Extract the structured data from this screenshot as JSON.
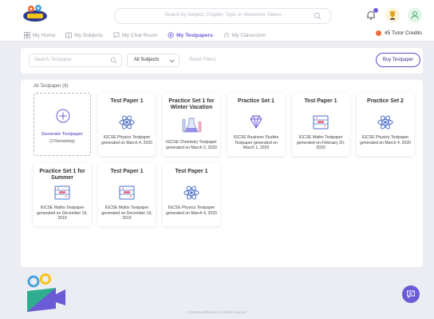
{
  "header": {
    "search_placeholder": "Search by Subject, Chapter, Topic or Interactive Videos",
    "notification_count": "",
    "credits_label": "45 Tutor Credits"
  },
  "nav": {
    "items": [
      {
        "label": "My Home",
        "icon": "grid-icon"
      },
      {
        "label": "My Subjects",
        "icon": "book-icon"
      },
      {
        "label": "My Chat Room",
        "icon": "chat-icon"
      },
      {
        "label": "My Testpapers",
        "icon": "testpaper-icon",
        "active": true
      },
      {
        "label": "My Classroom",
        "icon": "classroom-icon"
      }
    ]
  },
  "filters": {
    "search_placeholder": "Search Testpaper",
    "subject_select": "All Subjects",
    "reset_label": "Reset Filters",
    "buy_label": "Buy Testpaper"
  },
  "panel": {
    "title": "All Testpaper (8)",
    "generate": {
      "label": "Generate Testpaper",
      "sub": "(2 Remaining)"
    }
  },
  "cards": [
    {
      "title": "Test Paper 1",
      "icon": "atom-icon",
      "desc": "IGCSE Physics Testpaper generated on March 4, 2020"
    },
    {
      "title": "Practice Set 1 for Winter Vacation",
      "icon": "flask-icon",
      "desc": "IGCSE Chemistry Testpaper generated on March 2, 2020"
    },
    {
      "title": "Practice Set 1",
      "icon": "diamond-icon",
      "desc": "IGCSE Business Studies Testpaper generated on March 1, 2020"
    },
    {
      "title": "Test Paper 1",
      "icon": "abacus-icon",
      "desc": "IGCSE Maths Testpaper generated on February 20, 2020"
    },
    {
      "title": "Practice Set 2",
      "icon": "atom-icon",
      "desc": "IGCSE Physics Testpaper generated on March 4, 2020"
    },
    {
      "title": "Practice Set 1 for Summer",
      "icon": "abacus-icon",
      "desc": "IGCSE Maths Testpaper generated on December 19, 2019"
    },
    {
      "title": "Test Paper 1",
      "icon": "abacus-icon",
      "desc": "IGCSE Maths Testpaper generated on December 19, 2019"
    },
    {
      "title": "Test Paper 1",
      "icon": "atom-icon",
      "desc": "IGCSE Physics Testpaper generated on March 4, 2020"
    }
  ],
  "footer": {
    "text": "© MySecondTeacher. All rights reserved."
  },
  "colors": {
    "accent": "#6a5bd8",
    "credit_dot": "#f26b3a",
    "background": "#ecedf3"
  }
}
